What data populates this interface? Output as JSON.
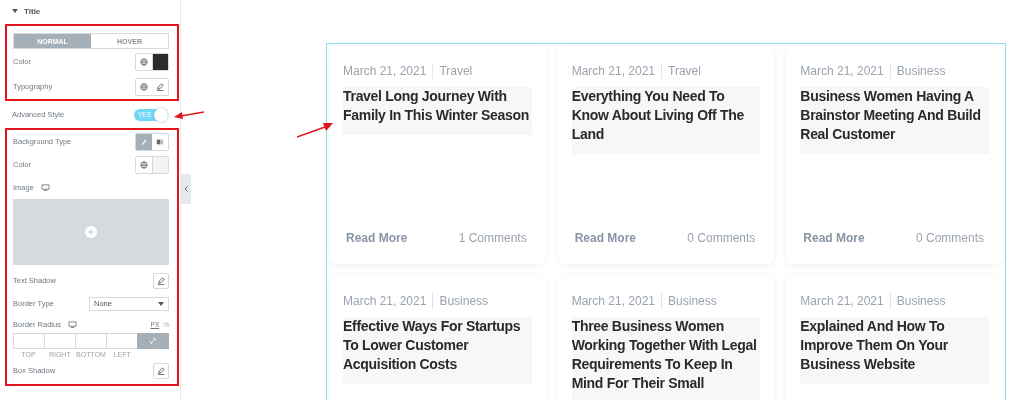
{
  "panel": {
    "section": "Title",
    "tabs": [
      {
        "label": "NORMAL",
        "selected": true
      },
      {
        "label": "HOVER",
        "selected": false
      }
    ],
    "style_controls": [
      {
        "kind": "color",
        "label": "Color",
        "color": "#2b2b2b"
      },
      {
        "kind": "typography",
        "label": "Typography"
      }
    ],
    "advanced": {
      "label": "Advanced Style",
      "on": true,
      "toggle_text": "YES"
    },
    "advanced_controls": [
      {
        "kind": "bgtype",
        "label": "Background Type",
        "classic_selected": true
      },
      {
        "kind": "color",
        "label": "Color",
        "color": "#f4f4f4"
      },
      {
        "kind": "image",
        "label": "Image"
      },
      {
        "kind": "edit",
        "label": "Text Shadow"
      },
      {
        "kind": "select",
        "label": "Border Type",
        "value": "None"
      },
      {
        "kind": "dimensions",
        "label": "Border Radius",
        "units": [
          "PX",
          "%"
        ],
        "sides": [
          "TOP",
          "RIGHT",
          "BOTTOM",
          "LEFT"
        ],
        "linked": true
      },
      {
        "kind": "edit",
        "label": "Box Shadow"
      }
    ]
  },
  "posts": [
    {
      "date": "March 21, 2021",
      "category": "Travel",
      "title": "Travel Long Journey With Family In This Winter Season",
      "read_more": "Read More",
      "comments": "1 Comments"
    },
    {
      "date": "March 21, 2021",
      "category": "Travel",
      "title": "Everything You Need To Know About Living Off The Land",
      "read_more": "Read More",
      "comments": "0 Comments"
    },
    {
      "date": "March 21, 2021",
      "category": "Business",
      "title": "Business Women Having A Brainstor Meeting And Build Real Customer",
      "read_more": "Read More",
      "comments": "0 Comments"
    },
    {
      "date": "March 21, 2021",
      "category": "Business",
      "title": "Effective Ways For Startups To Lower Customer Acquisition Costs"
    },
    {
      "date": "March 21, 2021",
      "category": "Business",
      "title": "Three Business Women Working Together With Legal Requirements To Keep In Mind For Their Small"
    },
    {
      "date": "March 21, 2021",
      "category": "Business",
      "title": "Explained And How To Improve Them On Your Business Website"
    }
  ]
}
